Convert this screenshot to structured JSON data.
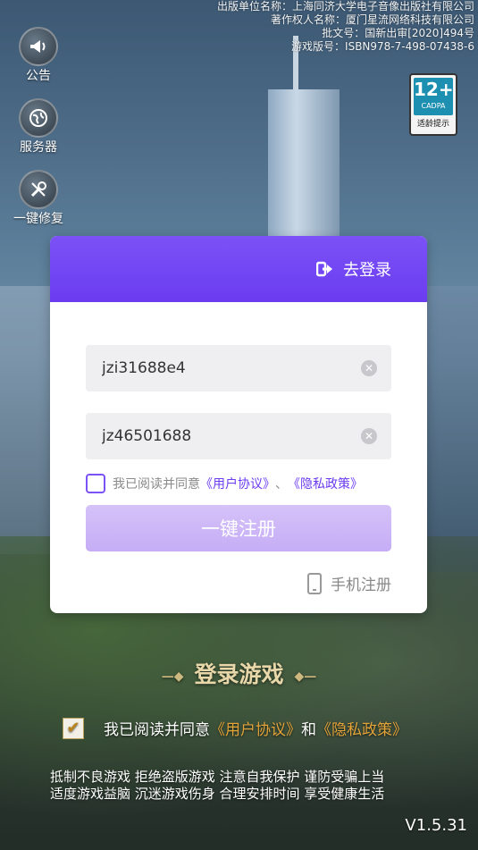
{
  "publisher": {
    "line1": "出版单位名称：上海同济大学电子音像出版社有限公司",
    "line2": "著作权人名称：厦门星流网络科技有限公司",
    "line3": "批文号：国新出审[2020]494号",
    "line4": "游戏版号：ISBN978-7-498-07438-6"
  },
  "sidebar": {
    "notice_label": "公告",
    "server_label": "服务器",
    "repair_label": "一键修复"
  },
  "age_rating": {
    "age": "12+",
    "org": "CADPA",
    "tip": "适龄提示"
  },
  "dialog": {
    "goto_login": "去登录",
    "account_value": "jzi31688e4",
    "password_value": "jz46501688",
    "agree_prefix": "我已阅读并同意",
    "user_agreement": "《用户协议》",
    "separator": "、",
    "privacy_policy": "《隐私政策》",
    "register_button": "一键注册",
    "phone_register": "手机注册"
  },
  "login_title": "登录游戏",
  "bottom_agree": {
    "prefix": "我已阅读并同意",
    "user_agreement": "《用户协议》",
    "and": "和",
    "privacy_policy": "《隐私政策》"
  },
  "health_notice": {
    "line1": "抵制不良游戏 拒绝盗版游戏 注意自我保护 谨防受骗上当",
    "line2": "适度游戏益脑 沉迷游戏伤身 合理安排时间 享受健康生活"
  },
  "version": "V1.5.31",
  "colors": {
    "accent": "#6b3cf0",
    "gold": "#e3a43a"
  }
}
